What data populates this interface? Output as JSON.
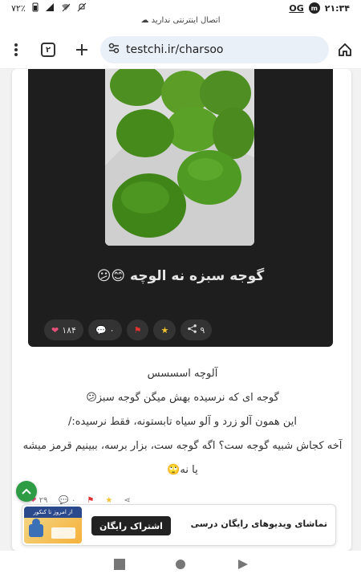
{
  "status": {
    "time": "۲۱:۳۴",
    "battery": "۷۲٪",
    "badge1": "OG",
    "badge2": "m"
  },
  "offline_notice": "اتصال اینترنتی ندارید",
  "browser": {
    "url": "testchi.ir/charsoo",
    "tab_count": "۲"
  },
  "post": {
    "image_caption": "گوجه سبزه نه الوچه 😊😕",
    "image_actions": {
      "likes": "۱۸۴",
      "comments": "۰",
      "shares": "۹"
    },
    "lines": [
      "آلوچه اسسسس",
      "گوجه ای که نرسیده بهش میگن گوجه سبز😕",
      "این همون آلو زرد و آلو سیاه تابستونه، فقط نرسیده:/",
      "آخه کجاش شبیه گوجه ست؟ اگه گوجه ست، بزار  برسه، ببینیم قرمز میشه یا نه🙄"
    ],
    "bottom_actions": {
      "likes": "۲۹",
      "comments": "۰"
    }
  },
  "ad": {
    "thumb_text": "از امروز تا کنکور",
    "button_label": "اشتراک رایگان",
    "text": "تماشای ویدیوهای رایگان درسی"
  },
  "colors": {
    "accent_green": "#2e9b45",
    "heart": "#e8507a",
    "flag": "#d33",
    "star": "#f2c12e"
  }
}
